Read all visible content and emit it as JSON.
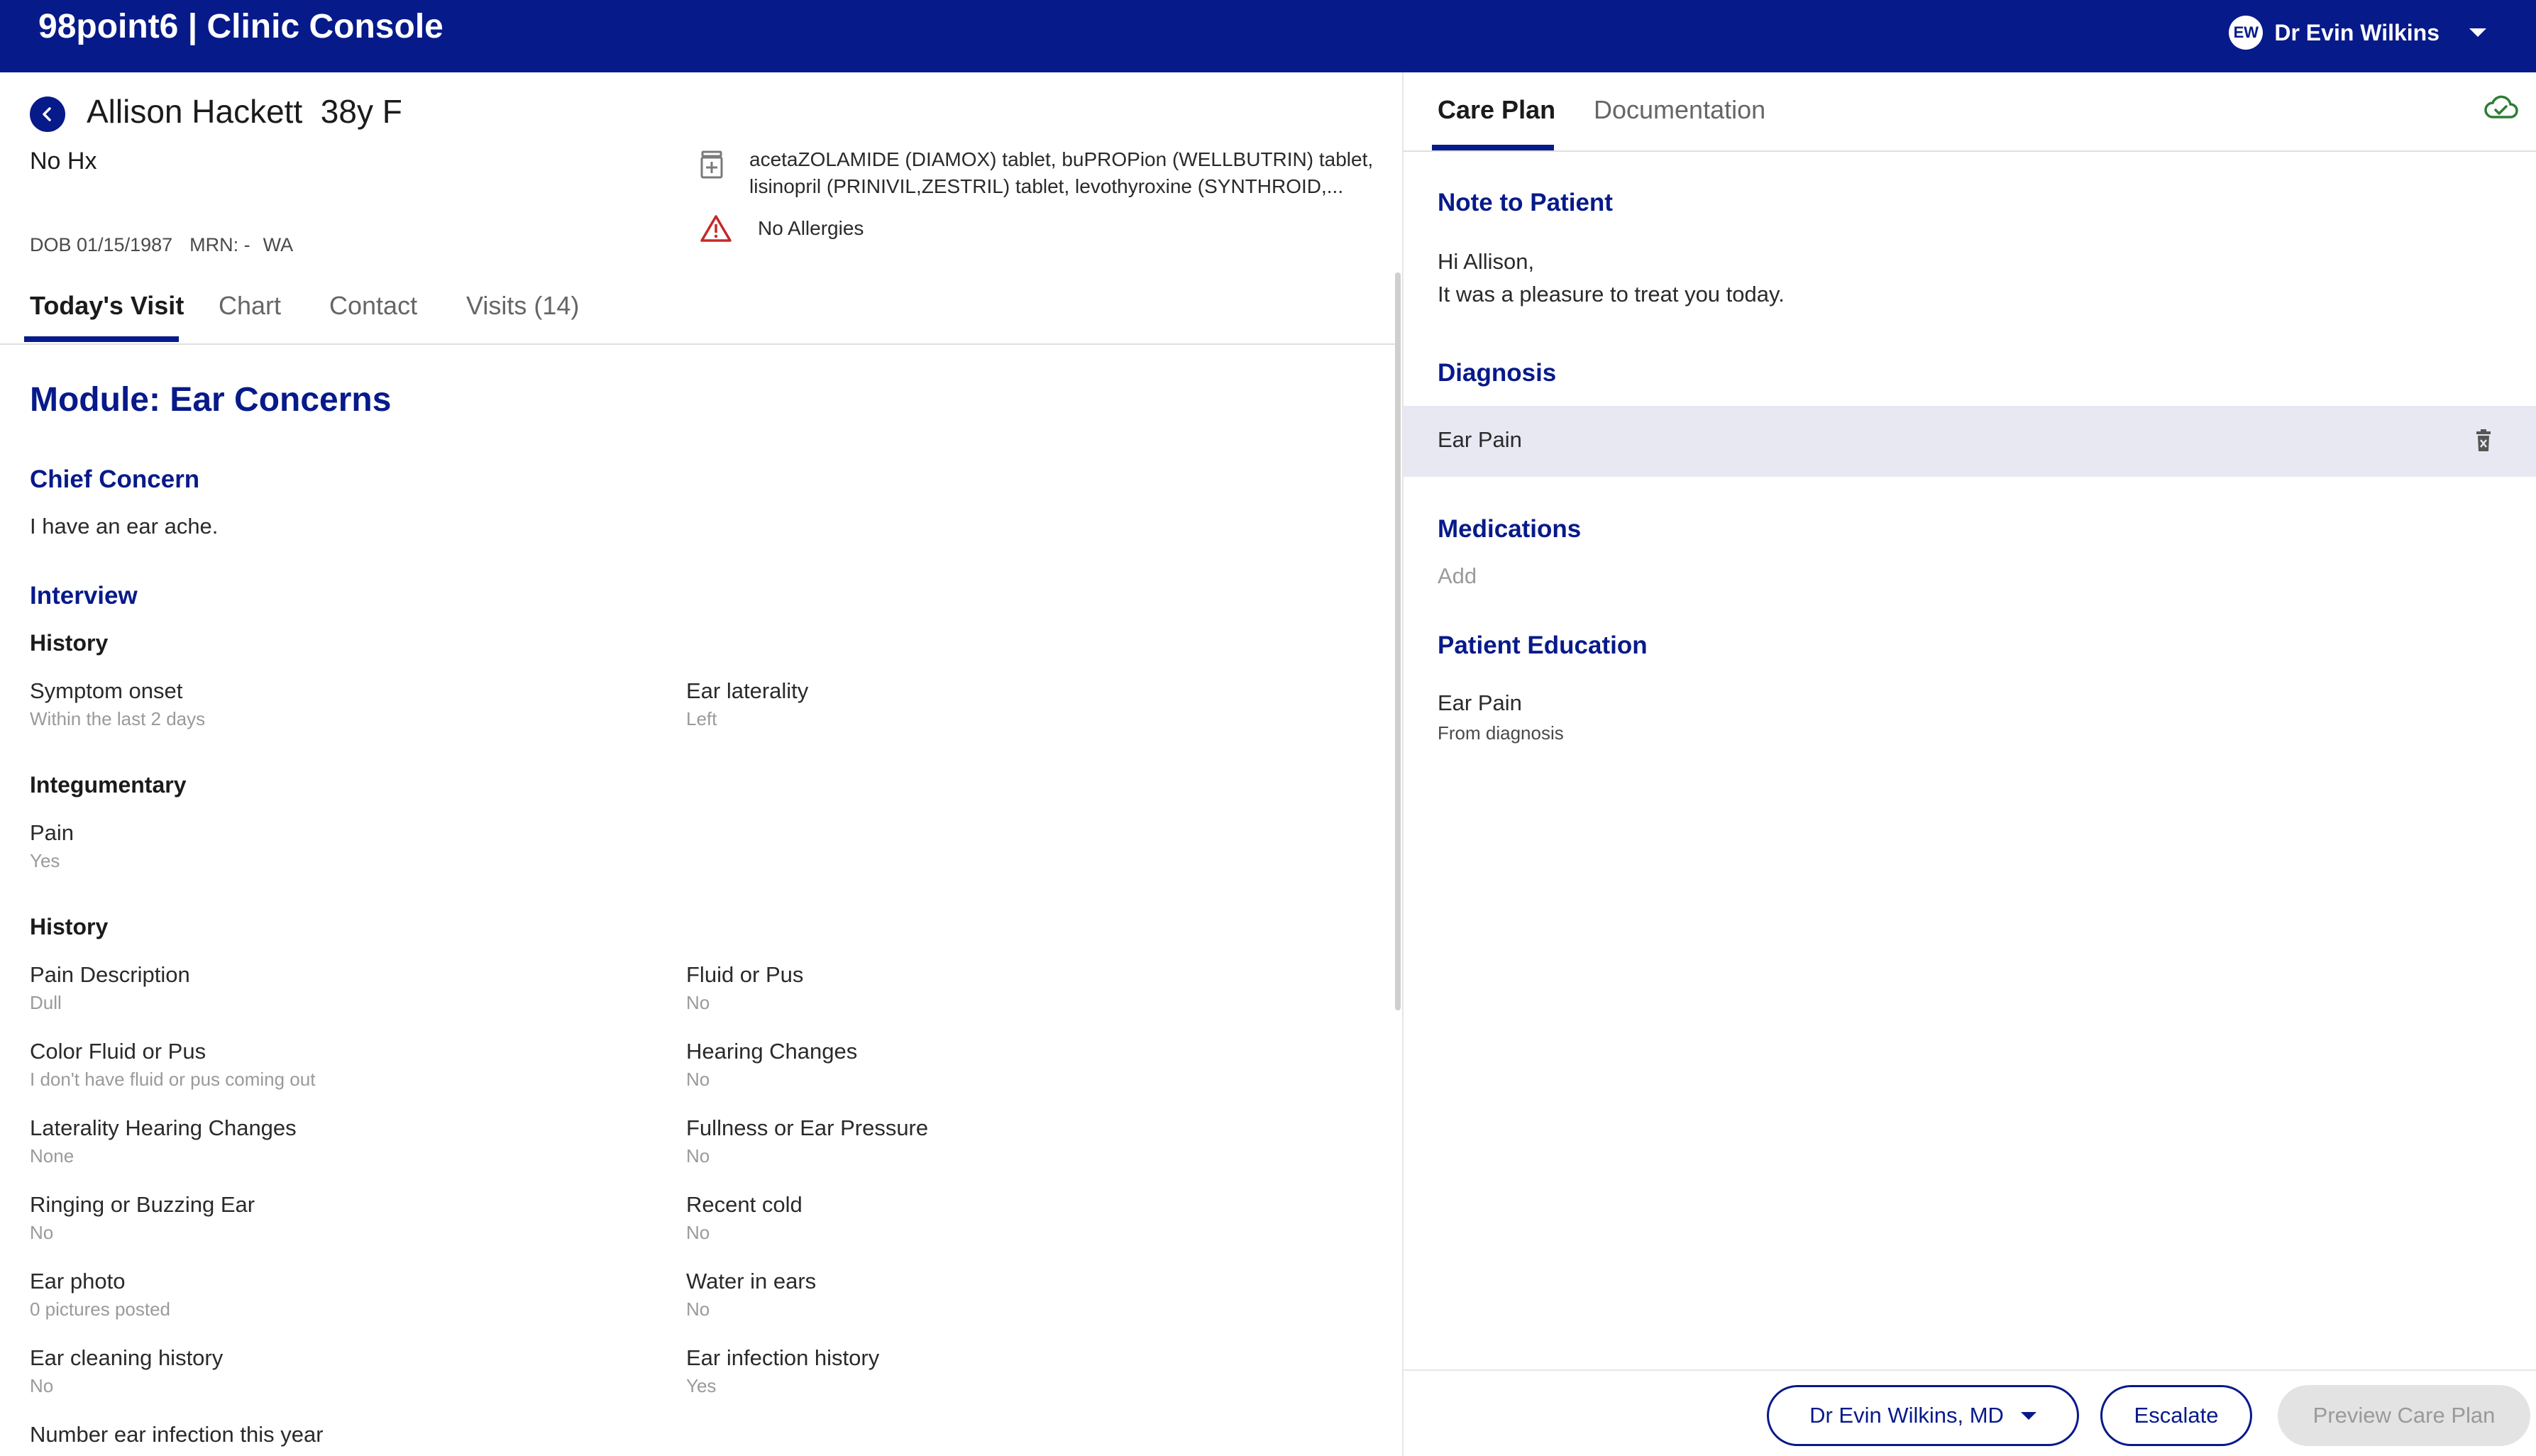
{
  "header": {
    "brand": "98point6 | Clinic Console",
    "user_initials": "EW",
    "user_name": "Dr Evin Wilkins"
  },
  "patient": {
    "name": "Allison Hackett  38y F",
    "history": "No Hx",
    "dob": "DOB 01/15/1987",
    "mrn": "MRN: -",
    "state": "WA",
    "medications": "acetaZOLAMIDE (DIAMOX) tablet, buPROPion (WELLBUTRIN) tablet, lisinopril (PRINIVIL,ZESTRIL) tablet, levothyroxine (SYNTHROID,...",
    "allergies": "No Allergies"
  },
  "tabs": [
    "Today's Visit",
    "Chart",
    "Contact",
    "Visits (14)"
  ],
  "module": {
    "title": "Module: Ear Concerns",
    "chief_concern_heading": "Chief Concern",
    "chief_concern": "I have an ear ache.",
    "interview_heading": "Interview",
    "history1_heading": "History",
    "symptom_onset_label": "Symptom onset",
    "symptom_onset_value": "Within the last 2 days",
    "ear_laterality_label": "Ear laterality",
    "ear_laterality_value": "Left",
    "integumentary_heading": "Integumentary",
    "pain_label": "Pain",
    "pain_value": "Yes",
    "history2_heading": "History",
    "fields": [
      {
        "label": "Pain Description",
        "value": "Dull"
      },
      {
        "label": "Fluid or Pus",
        "value": "No"
      },
      {
        "label": "Color Fluid or Pus",
        "value": "I don't have fluid or pus coming out"
      },
      {
        "label": "Hearing Changes",
        "value": "No"
      },
      {
        "label": "Laterality Hearing Changes",
        "value": "None"
      },
      {
        "label": "Fullness or Ear Pressure",
        "value": "No"
      },
      {
        "label": "Ringing or Buzzing Ear",
        "value": "No"
      },
      {
        "label": "Recent cold",
        "value": "No"
      },
      {
        "label": "Ear photo",
        "value": "0 pictures posted"
      },
      {
        "label": "Water in ears",
        "value": "No"
      },
      {
        "label": "Ear cleaning history",
        "value": "No"
      },
      {
        "label": "Ear infection history",
        "value": "Yes"
      }
    ],
    "last_label": "Number ear infection this year"
  },
  "right": {
    "tabs": [
      "Care Plan",
      "Documentation"
    ],
    "note_heading": "Note to Patient",
    "note_line1": "Hi Allison,",
    "note_line2": "It was a pleasure to treat you today.",
    "diagnosis_heading": "Diagnosis",
    "diagnosis": "Ear Pain",
    "medications_heading": "Medications",
    "medications_add": "Add",
    "education_heading": "Patient Education",
    "education_item": "Ear Pain",
    "education_source": "From diagnosis"
  },
  "footer": {
    "doctor_select": "Dr Evin Wilkins, MD",
    "escalate": "Escalate",
    "preview": "Preview Care Plan"
  },
  "colors": {
    "brand_navy": "#071a8a",
    "diagnosis_bg": "#e8e8f3",
    "allergy_red": "#c62828",
    "cloud_green": "#2e7d32"
  }
}
